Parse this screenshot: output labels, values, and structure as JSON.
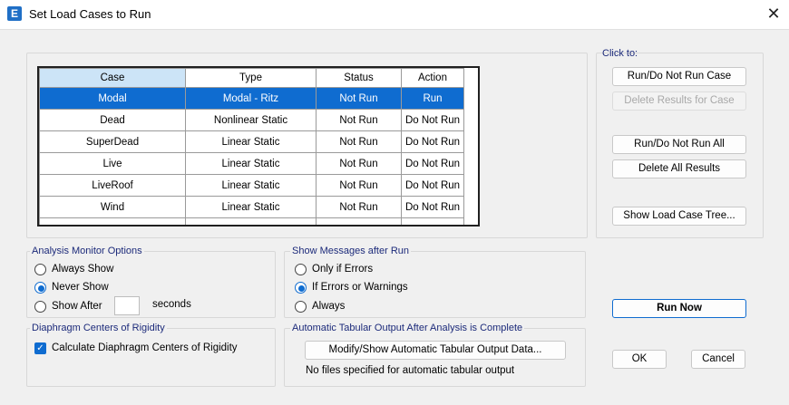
{
  "window": {
    "title": "Set Load Cases to Run",
    "app_icon": "E"
  },
  "table": {
    "headers": [
      "Case",
      "Type",
      "Status",
      "Action"
    ],
    "rows": [
      [
        "Modal",
        "Modal - Ritz",
        "Not Run",
        "Run"
      ],
      [
        "Dead",
        "Nonlinear Static",
        "Not Run",
        "Do Not Run"
      ],
      [
        "SuperDead",
        "Linear Static",
        "Not Run",
        "Do Not Run"
      ],
      [
        "Live",
        "Linear Static",
        "Not Run",
        "Do Not Run"
      ],
      [
        "LiveRoof",
        "Linear Static",
        "Not Run",
        "Do Not Run"
      ],
      [
        "Wind",
        "Linear Static",
        "Not Run",
        "Do Not Run"
      ]
    ]
  },
  "click_to": {
    "label": "Click to:",
    "run_do_not_run_case": "Run/Do Not Run Case",
    "delete_results_for_case": "Delete Results for Case",
    "run_do_not_run_all": "Run/Do Not Run All",
    "delete_all_results": "Delete All Results",
    "show_load_case_tree": "Show Load Case Tree..."
  },
  "analysis_monitor": {
    "title": "Analysis Monitor Options",
    "always_show": "Always Show",
    "never_show": "Never Show",
    "show_after": "Show After",
    "seconds_value": "",
    "seconds_label": "seconds",
    "selected": "never_show"
  },
  "show_messages": {
    "title": "Show Messages after Run",
    "only_if_errors": "Only if Errors",
    "if_errors_or_warnings": "If Errors or Warnings",
    "always": "Always",
    "selected": "if_errors_or_warnings"
  },
  "diaphragm": {
    "title": "Diaphragm Centers of Rigidity",
    "calculate_label": "Calculate Diaphragm Centers of Rigidity",
    "checked": true
  },
  "auto_output": {
    "title": "Automatic Tabular Output After Analysis is Complete",
    "modify_button": "Modify/Show Automatic Tabular Output Data...",
    "status": "No files specified for automatic tabular output"
  },
  "actions": {
    "run_now": "Run Now",
    "ok": "OK",
    "cancel": "Cancel"
  },
  "colors": {
    "accent": "#0f6cd0",
    "header_selected": "#cce4f7",
    "group_label": "#1c2a7a"
  }
}
